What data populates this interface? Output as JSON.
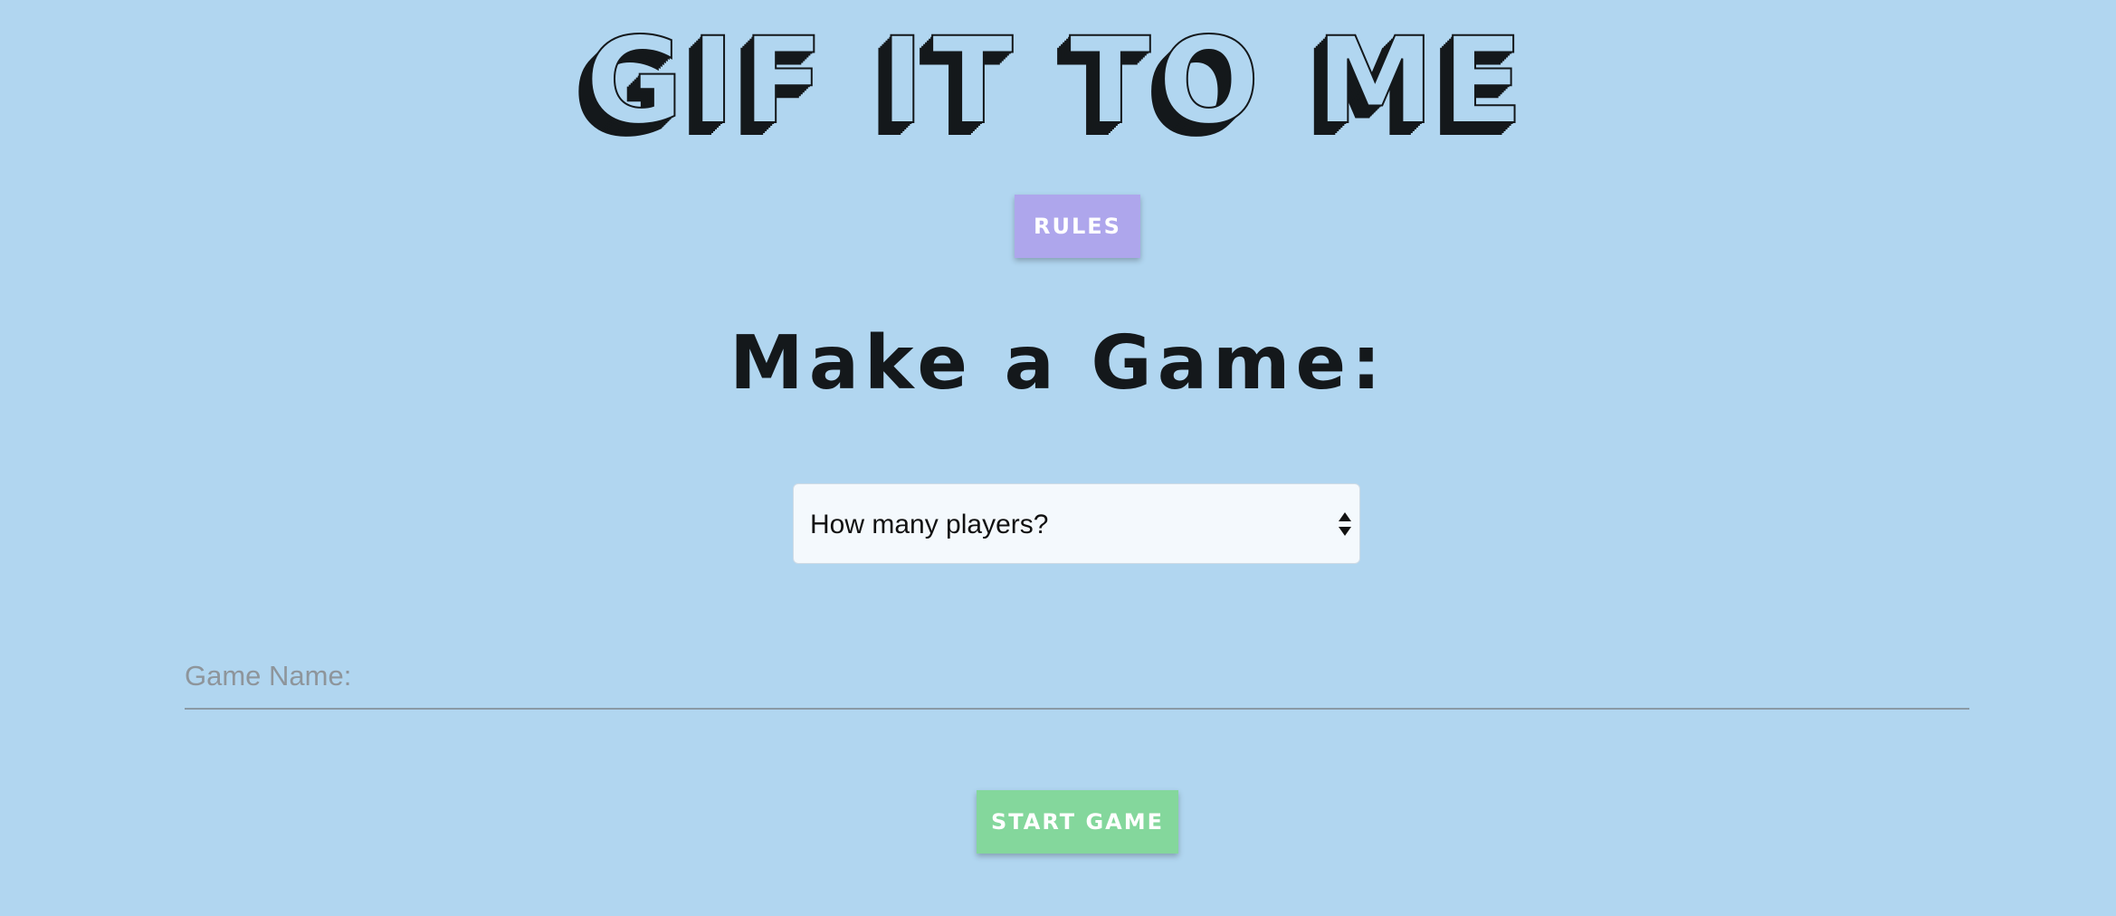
{
  "header": {
    "logo_text": "GIF IT TO ME"
  },
  "rules_button": {
    "label": "RULES"
  },
  "main": {
    "heading": "Make a Game:",
    "players_select": {
      "selected": "How many players?",
      "icon": "select-arrows-icon"
    },
    "game_name_input": {
      "value": "",
      "placeholder": "Game Name:"
    },
    "start_button": {
      "label": "START GAME"
    }
  },
  "colors": {
    "background": "#b1d6f0",
    "rules_button": "#aea6ec",
    "start_button": "#84d79c",
    "text_dark": "#14181b"
  }
}
